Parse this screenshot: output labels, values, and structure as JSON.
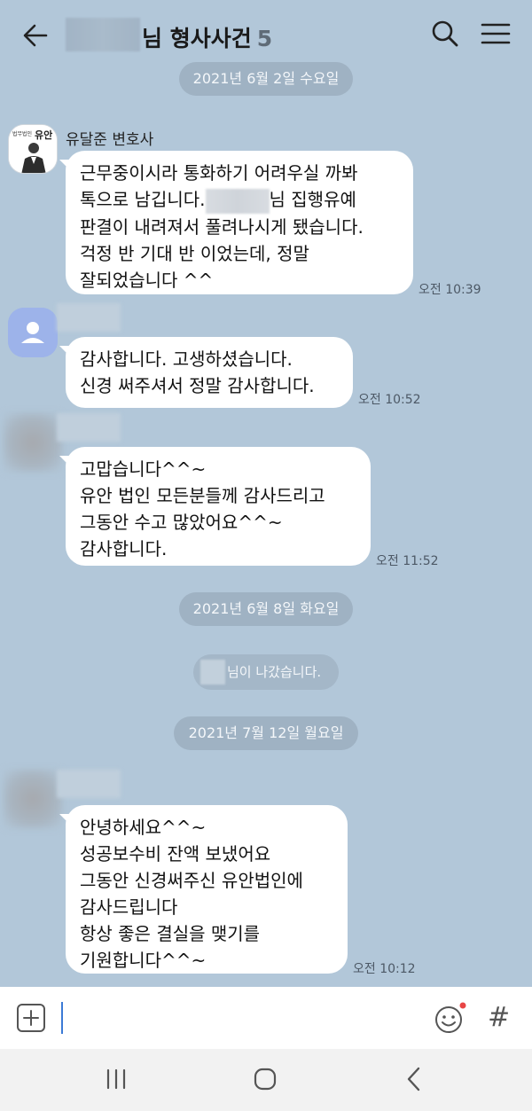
{
  "header": {
    "title": "님 형사사건",
    "member_count": "5"
  },
  "dates": {
    "d1": "2021년 6월 2일 수요일",
    "d2": "2021년 6월 8일 화요일",
    "d3": "2021년 7월 12일 월요일"
  },
  "messages": [
    {
      "sender": "유달준 변호사",
      "avatar_text": "법무법인 유안",
      "lines": [
        "근무중이시라 통화하기 어려우실 까봐",
        "톡으로 남깁니다.",
        "님 집행유예",
        "판결이 내려져서 풀려나시게 됐습니다.",
        "걱정 반 기대 반 이었는데, 정말",
        "잘되었습니다 ^^"
      ],
      "time": "오전 10:39"
    },
    {
      "lines": [
        "감사합니다. 고생하셨습니다.",
        "신경 써주셔서 정말 감사합니다."
      ],
      "time": "오전 10:52"
    },
    {
      "lines": [
        "고맙습니다^^~",
        "유안 법인 모든분들께 감사드리고",
        "그동안 수고 많았어요^^~",
        "감사합니다."
      ],
      "time": "오전 11:52"
    },
    {
      "lines": [
        "안녕하세요^^~",
        "성공보수비 잔액 보냈어요",
        "그동안 신경써주신 유안법인에",
        "감사드립니다",
        "항상 좋은 결실을 맺기를",
        "기원합니다^^~"
      ],
      "time": "오전 10:12"
    }
  ],
  "system": {
    "left_msg": "님이 나갔습니다."
  },
  "input": {
    "hash_label": "#"
  },
  "icons": {
    "back": "arrow-left-icon",
    "search": "search-icon",
    "menu": "hamburger-menu-icon",
    "plus": "plus-square-icon",
    "emoji": "emoji-icon",
    "notification_dot_color": "#e84545"
  },
  "colors": {
    "chat_background": "#b2c7d9",
    "bubble": "#ffffff",
    "date_pill": "#9fb2c3"
  }
}
